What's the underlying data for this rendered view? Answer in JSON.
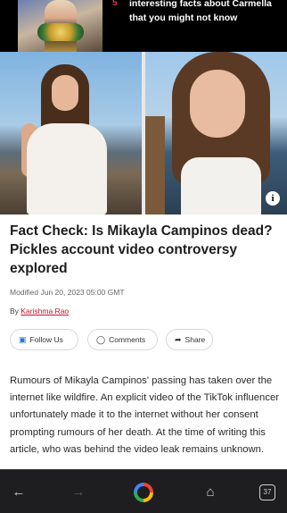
{
  "promo": {
    "count": "5",
    "title": "interesting facts about Carmella that you might not know"
  },
  "hero": {
    "info_label": "i"
  },
  "article": {
    "title": "Fact Check: Is Mikayla Campinos dead? Pickles account video controversy explored",
    "modified": "Modified Jun 20, 2023 05:00 GMT",
    "by_prefix": "By",
    "author": "Karishma Rao",
    "actions": {
      "follow": "Follow Us",
      "comments": "Comments",
      "share": "Share"
    },
    "body": "Rumours of Mikayla Campinos' passing has taken over the internet like wildfire. An explicit video of the TikTok influencer unfortunately made it to the internet without her consent prompting rumours of her death. At the time of writing this article, who was behind the video leak remains unknown."
  },
  "browser": {
    "tab_count": "37"
  }
}
